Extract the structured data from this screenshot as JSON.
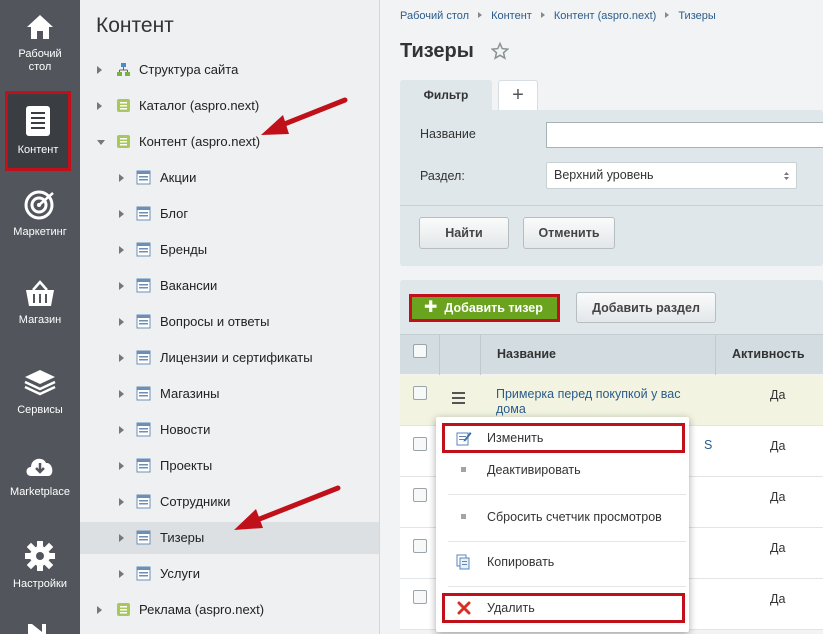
{
  "leftnav": {
    "items": [
      {
        "label_1": "Рабочий",
        "label_2": "стол",
        "icon": "home-icon"
      },
      {
        "label_1": "Контент",
        "label_2": "",
        "icon": "document-icon"
      },
      {
        "label_1": "Маркетинг",
        "label_2": "",
        "icon": "target-icon"
      },
      {
        "label_1": "Магазин",
        "label_2": "",
        "icon": "basket-icon"
      },
      {
        "label_1": "Сервисы",
        "label_2": "",
        "icon": "layers-icon"
      },
      {
        "label_1": "Marketplace",
        "label_2": "",
        "icon": "cloud-download-icon"
      },
      {
        "label_1": "Настройки",
        "label_2": "",
        "icon": "gear-icon"
      }
    ]
  },
  "tree": {
    "title": "Контент",
    "items": [
      {
        "label": "Структура сайта"
      },
      {
        "label": "Каталог (aspro.next)"
      },
      {
        "label": "Контент (aspro.next)"
      },
      {
        "label": "Акции"
      },
      {
        "label": "Блог"
      },
      {
        "label": "Бренды"
      },
      {
        "label": "Вакансии"
      },
      {
        "label": "Вопросы и ответы"
      },
      {
        "label": "Лицензии и сертификаты"
      },
      {
        "label": "Магазины"
      },
      {
        "label": "Новости"
      },
      {
        "label": "Проекты"
      },
      {
        "label": "Сотрудники"
      },
      {
        "label": "Тизеры"
      },
      {
        "label": "Услуги"
      },
      {
        "label": "Реклама (aspro.next)"
      }
    ]
  },
  "breadcrumb": [
    "Рабочий стол",
    "Контент",
    "Контент (aspro.next)",
    "Тизеры"
  ],
  "page": {
    "title": "Тизеры"
  },
  "filter": {
    "tab_label": "Фильтр",
    "add_tab_label": "+",
    "name_label": "Название",
    "section_label": "Раздел:",
    "section_value": "Верхний уровень",
    "find_label": "Найти",
    "cancel_label": "Отменить"
  },
  "toolbar": {
    "add_teaser_label": "Добавить тизер",
    "add_section_label": "Добавить раздел"
  },
  "table": {
    "headers": {
      "name": "Название",
      "activity": "Активность"
    },
    "rows": [
      {
        "name": "Примерка перед покупкой у вас дома",
        "activity": "Да"
      },
      {
        "name": "S",
        "activity": "Да"
      },
      {
        "name": "",
        "activity": "Да"
      },
      {
        "name": "",
        "activity": "Да"
      },
      {
        "name": "",
        "activity": "Да"
      }
    ]
  },
  "context_menu": {
    "edit": "Изменить",
    "deactivate": "Деактивировать",
    "reset_counter": "Сбросить счетчик просмотров",
    "copy": "Копировать",
    "delete": "Удалить"
  },
  "colors": {
    "accent_green": "#6aa31d",
    "highlight_red": "#c0111a",
    "link_blue": "#2a5c8c"
  }
}
